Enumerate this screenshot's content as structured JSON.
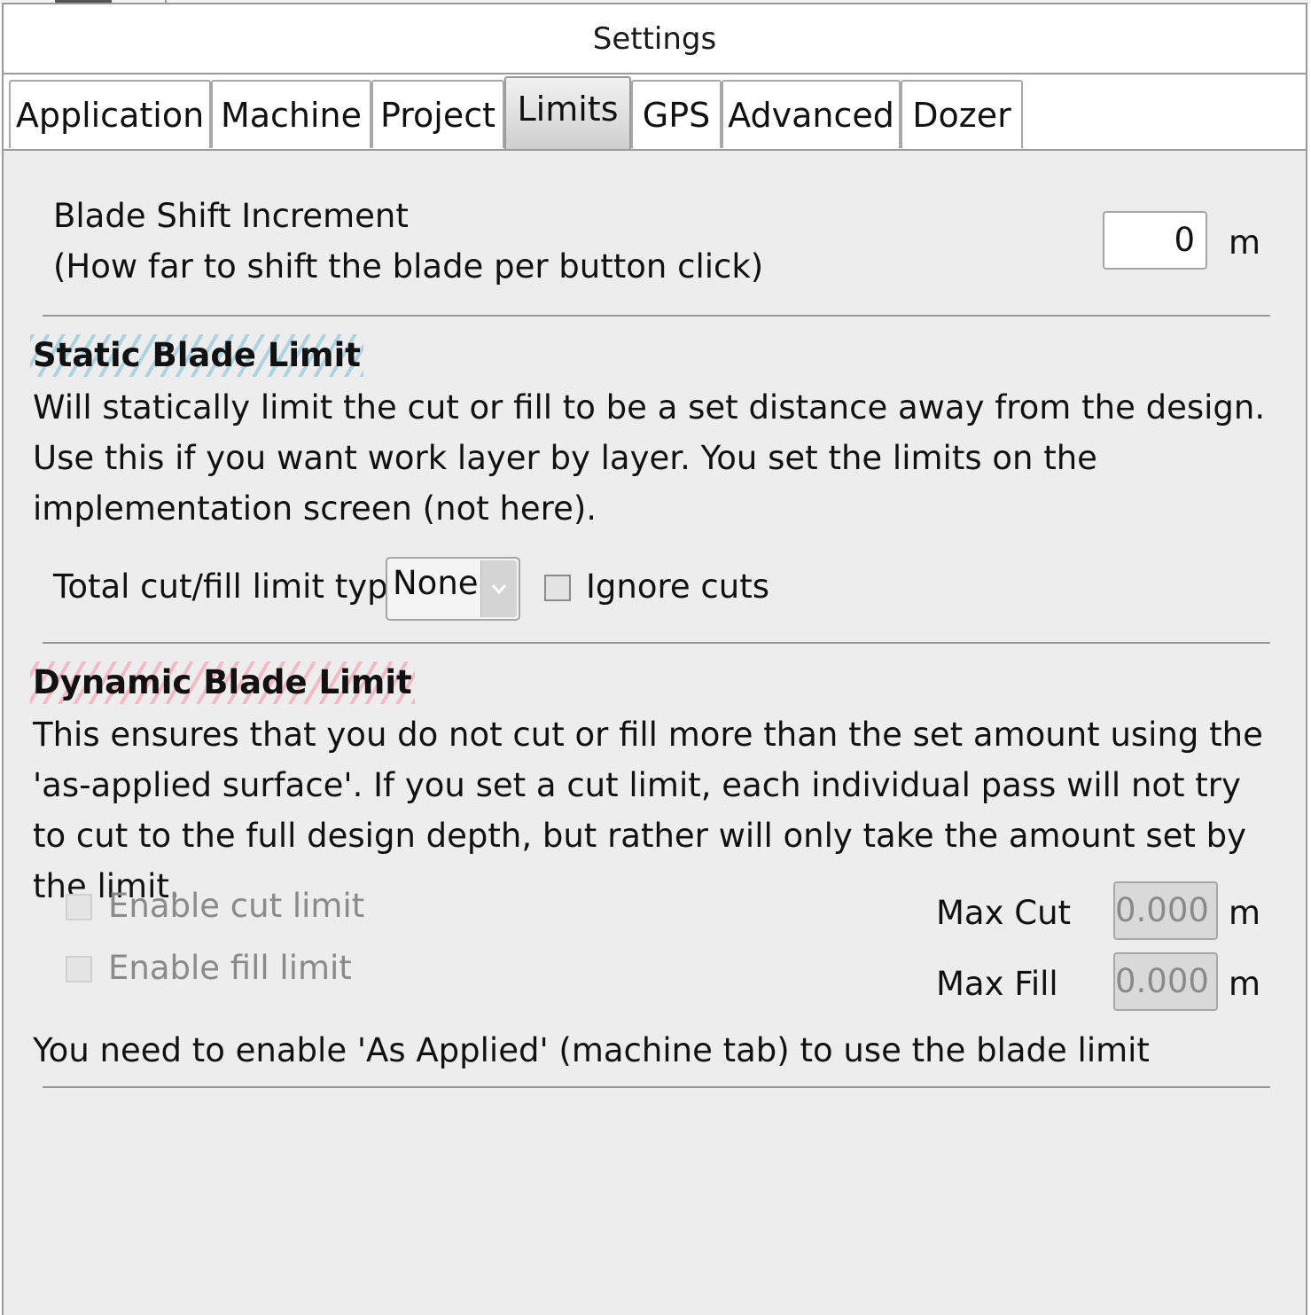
{
  "window": {
    "title": "Settings"
  },
  "tabs": [
    {
      "label": "Application"
    },
    {
      "label": "Machine"
    },
    {
      "label": "Project"
    },
    {
      "label": "Limits"
    },
    {
      "label": "GPS"
    },
    {
      "label": "Advanced"
    },
    {
      "label": "Dozer"
    }
  ],
  "active_tab": "Limits",
  "blade_shift": {
    "title": "Blade Shift Increment",
    "description": "(How far to shift the blade per button click)",
    "value": "0",
    "unit": "m"
  },
  "static_limit": {
    "heading": "Static Blade Limit",
    "description": "Will statically limit the cut or fill to be a set distance away from the design. Use this if you want work layer by layer. You set the limits on the implementation screen (not here).",
    "type_label": "Total cut/fill limit type",
    "type_value": "None",
    "ignore_cuts_label": "Ignore cuts",
    "ignore_cuts_checked": false
  },
  "dynamic_limit": {
    "heading": "Dynamic Blade Limit",
    "description": "This ensures that you do not cut or fill more than the set amount using the 'as-applied surface'. If you set a cut limit, each individual pass will not try to cut to the full design depth, but rather will only take the amount set by the limit.",
    "enable_cut_label": "Enable cut limit",
    "enable_fill_label": "Enable fill limit",
    "max_cut_label": "Max Cut",
    "max_cut_value": "0.000",
    "max_fill_label": "Max Fill",
    "max_fill_value": "0.000",
    "unit": "m",
    "note": "You need to enable 'As Applied' (machine tab) to use the blade limit"
  },
  "icons": {
    "dropdown": "chevron-down-icon"
  },
  "colors": {
    "panel": "#ededed",
    "border": "#9a9a9a",
    "disabled_text": "#8a8a8a"
  }
}
